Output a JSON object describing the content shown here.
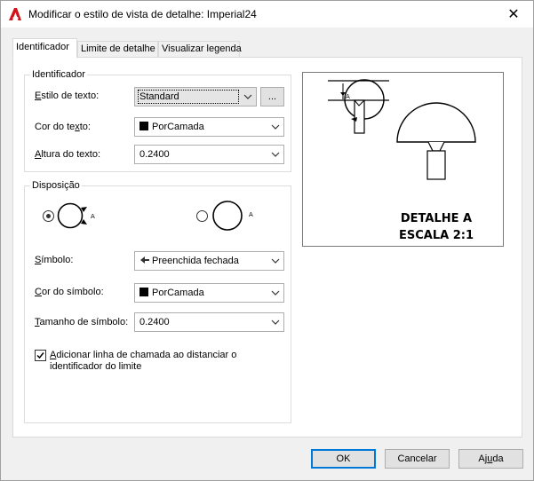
{
  "window": {
    "title": "Modificar o estilo de vista de detalhe: Imperial24",
    "close_glyph": "✕"
  },
  "tabs": [
    {
      "label": "Identificador",
      "active": true
    },
    {
      "label": "Limite de detalhe",
      "active": false
    },
    {
      "label": "Visualizar legenda",
      "active": false
    }
  ],
  "identifier_group": {
    "title": "Identificador",
    "text_style": {
      "label_pre": "",
      "label_u": "E",
      "label_post": "stilo de texto:",
      "value": "Standard",
      "browse_label": "..."
    },
    "text_color": {
      "label_pre": "Cor do te",
      "label_u": "x",
      "label_post": "to:",
      "value": "PorCamada"
    },
    "text_height": {
      "label_pre": "",
      "label_u": "A",
      "label_post": "ltura do texto:",
      "value": "0.2400"
    }
  },
  "layout_group": {
    "title": "Disposição",
    "option1_selected": true,
    "option2_selected": false,
    "symbol_letter": "A",
    "symbol": {
      "label_pre": "",
      "label_u": "S",
      "label_post": "ímbolo:",
      "value": "Preenchida fechada"
    },
    "symbol_color": {
      "label_pre": "",
      "label_u": "C",
      "label_post": "or do símbolo:",
      "value": "PorCamada"
    },
    "symbol_size": {
      "label_pre": "",
      "label_u": "T",
      "label_post": "amanho de símbolo:",
      "value": "0.2400"
    },
    "leader_checkbox": {
      "checked": true,
      "line1_pre": "",
      "line1_u": "A",
      "line1_post": "dicionar linha de chamada ao distanciar o",
      "line2": "identificador do limite"
    }
  },
  "preview": {
    "caption_line1": "DETALHE A",
    "caption_line2": "ESCALA 2:1",
    "marker_letter": "A"
  },
  "buttons": {
    "ok": "OK",
    "cancel": "Cancelar",
    "help_pre": "Aj",
    "help_u": "u",
    "help_post": "da"
  },
  "colors": {
    "accent": "#0078d7",
    "autodesk_red": "#d0121b"
  }
}
